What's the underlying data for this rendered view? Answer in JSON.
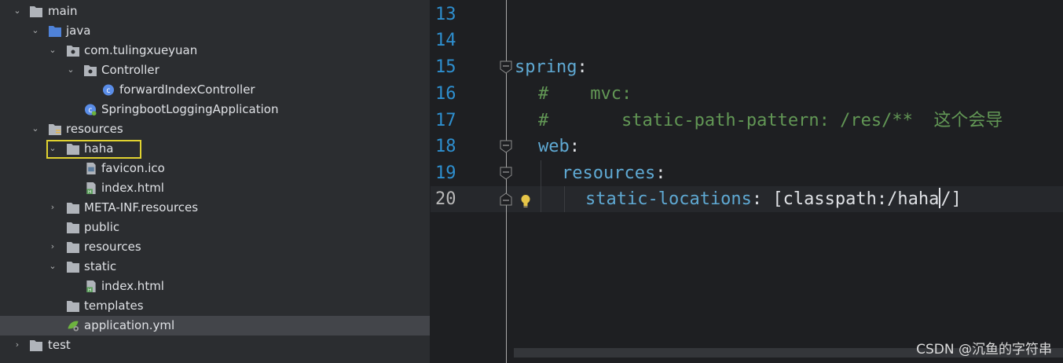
{
  "tree": {
    "items": [
      {
        "label": "main",
        "depth": 0,
        "expanded": true,
        "icon": "folder-icon"
      },
      {
        "label": "java",
        "depth": 1,
        "expanded": true,
        "icon": "source-folder-icon"
      },
      {
        "label": "com.tulingxueyuan",
        "depth": 2,
        "expanded": true,
        "icon": "package-icon"
      },
      {
        "label": "Controller",
        "depth": 3,
        "expanded": true,
        "icon": "package-icon"
      },
      {
        "label": "forwardIndexController",
        "depth": 4,
        "icon": "class-icon"
      },
      {
        "label": "SpringbootLoggingApplication",
        "depth": 3,
        "icon": "spring-boot-class-icon"
      },
      {
        "label": "resources",
        "depth": 1,
        "expanded": true,
        "icon": "resources-folder-icon"
      },
      {
        "label": "haha",
        "depth": 2,
        "expanded": true,
        "icon": "folder-icon"
      },
      {
        "label": "favicon.ico",
        "depth": 3,
        "icon": "ico-file-icon"
      },
      {
        "label": "index.html",
        "depth": 3,
        "icon": "html-file-icon"
      },
      {
        "label": "META-INF.resources",
        "depth": 2,
        "expanded": false,
        "icon": "folder-icon"
      },
      {
        "label": "public",
        "depth": 2,
        "icon": "folder-icon"
      },
      {
        "label": "resources",
        "depth": 2,
        "expanded": false,
        "icon": "folder-icon"
      },
      {
        "label": "static",
        "depth": 2,
        "expanded": true,
        "icon": "folder-icon"
      },
      {
        "label": "index.html",
        "depth": 3,
        "icon": "html-file-icon"
      },
      {
        "label": "templates",
        "depth": 2,
        "icon": "folder-icon"
      },
      {
        "label": "application.yml",
        "depth": 2,
        "icon": "yaml-file-icon",
        "selected": true
      },
      {
        "label": "test",
        "depth": 0,
        "expanded": false,
        "icon": "folder-icon"
      }
    ]
  },
  "editor": {
    "line_numbers": [
      "13",
      "14",
      "15",
      "16",
      "17",
      "18",
      "19",
      "20"
    ],
    "current_line": "20",
    "code": {
      "l15_key": "spring",
      "l15_colon": ":",
      "l16_comment": "#    mvc:",
      "l17_comment": "#       static-path-pattern: /res/**  这个会导",
      "l18_key": "web",
      "l18_colon": ":",
      "l19_key": "resources",
      "l19_colon": ":",
      "l20_key": "static-locations",
      "l20_colon": ": ",
      "l20_value_before_caret": "[classpath:/haha",
      "l20_value_after_caret": "/]"
    }
  },
  "watermark": "CSDN @沉鱼的字符串",
  "colors": {
    "tree_bg": "#2b2d30",
    "editor_bg": "#1e1f22",
    "key": "#5fa9d3",
    "comment": "#629755",
    "line_number": "#2e8fcf",
    "highlight_box": "#e0d230"
  }
}
